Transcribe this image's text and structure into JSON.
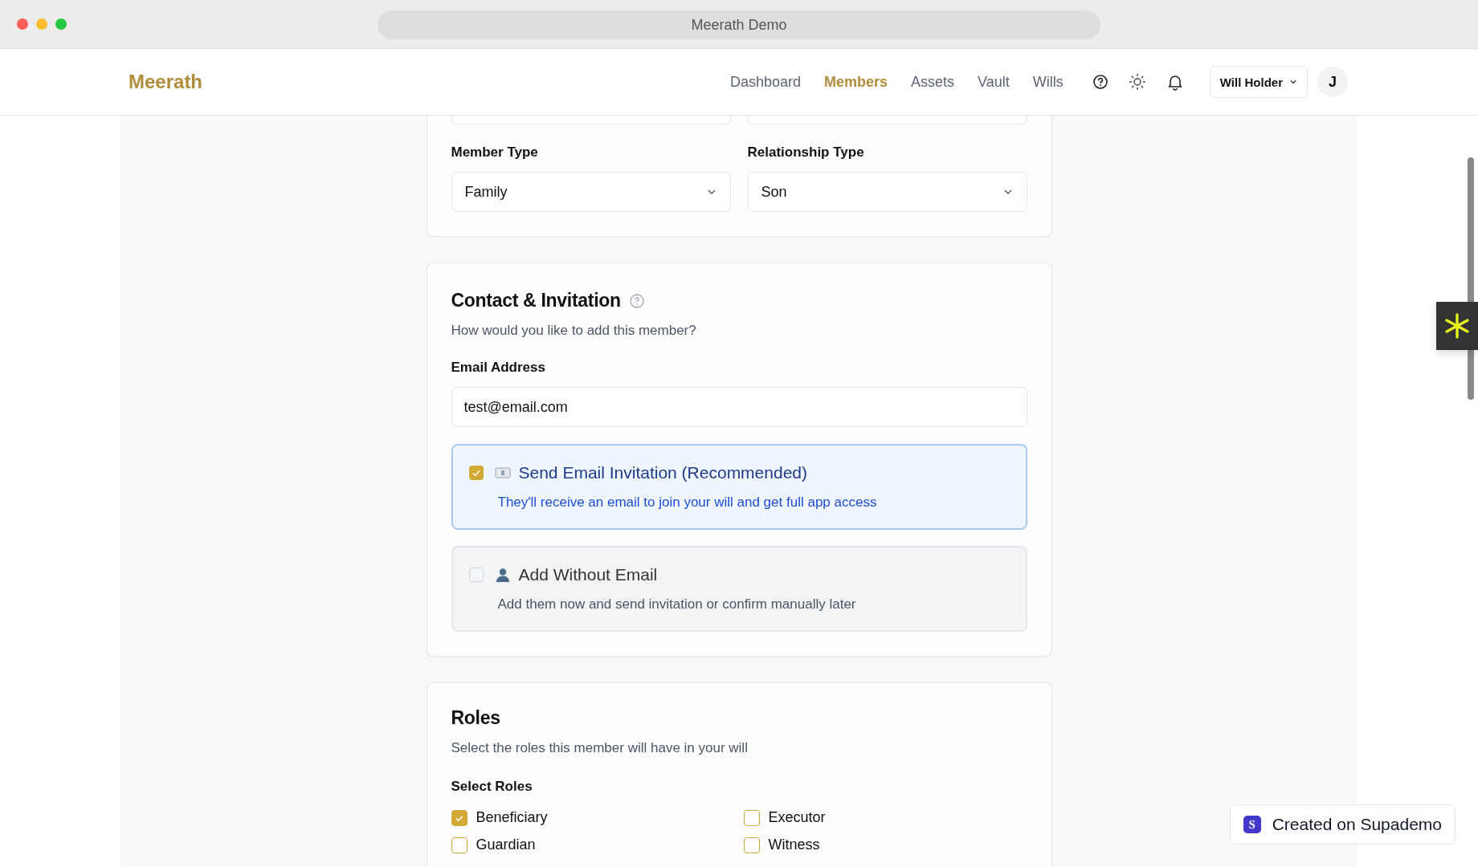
{
  "window": {
    "title": "Meerath Demo"
  },
  "header": {
    "logo": "Meerath",
    "nav": [
      {
        "label": "Dashboard",
        "selected": false
      },
      {
        "label": "Members",
        "selected": true
      },
      {
        "label": "Assets",
        "selected": false
      },
      {
        "label": "Vault",
        "selected": false
      },
      {
        "label": "Wills",
        "selected": false
      }
    ],
    "user_menu": "Will Holder",
    "avatar": "J"
  },
  "member_section": {
    "fields": [
      {
        "label": "Member Type",
        "value": "Family"
      },
      {
        "label": "Relationship Type",
        "value": "Son"
      }
    ]
  },
  "contact": {
    "title": "Contact & Invitation",
    "subtitle": "How would you like to add this member?",
    "email_label": "Email Address",
    "email_value": "test@email.com",
    "options": [
      {
        "kind": "email",
        "title": "Send Email Invitation (Recommended)",
        "description": "They'll receive an email to join your will and get full app access",
        "checked": true
      },
      {
        "kind": "person",
        "title": "Add Without Email",
        "description": "Add them now and send invitation or confirm manually later",
        "checked": false
      }
    ]
  },
  "roles": {
    "title": "Roles",
    "subtitle": "Select the roles this member will have in your will",
    "select_label": "Select Roles",
    "items": [
      {
        "label": "Beneficiary",
        "checked": true
      },
      {
        "label": "Executor",
        "checked": false
      },
      {
        "label": "Guardian",
        "checked": false
      },
      {
        "label": "Witness",
        "checked": false
      }
    ]
  },
  "badge": {
    "logo": "S",
    "text": "Created on Supademo"
  }
}
